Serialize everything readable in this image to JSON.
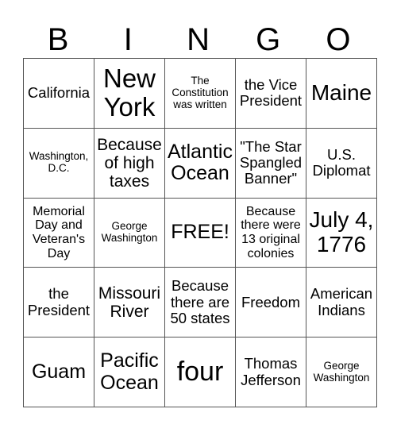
{
  "header": {
    "letters": [
      "B",
      "I",
      "N",
      "G",
      "O"
    ]
  },
  "board": {
    "rows": [
      [
        "California",
        "New York",
        "The Constitution was written",
        "the Vice President",
        "Maine"
      ],
      [
        "Washington, D.C.",
        "Because of high taxes",
        "Atlantic Ocean",
        "\"The Star Spangled Banner\"",
        "U.S. Diplomat"
      ],
      [
        "Memorial Day and Veteran's Day",
        "George Washington",
        "FREE!",
        "Because there were 13 original colonies",
        "July 4, 1776"
      ],
      [
        "the President",
        "Missouri River",
        "Because there are 50 states",
        "Freedom",
        "American Indians"
      ],
      [
        "Guam",
        "Pacific Ocean",
        "four",
        "Thomas Jefferson",
        "George Washington"
      ]
    ],
    "free_space": {
      "row": 2,
      "col": 2
    }
  },
  "colors": {
    "grid_line": "#555555",
    "text": "#000000",
    "background": "#ffffff"
  }
}
